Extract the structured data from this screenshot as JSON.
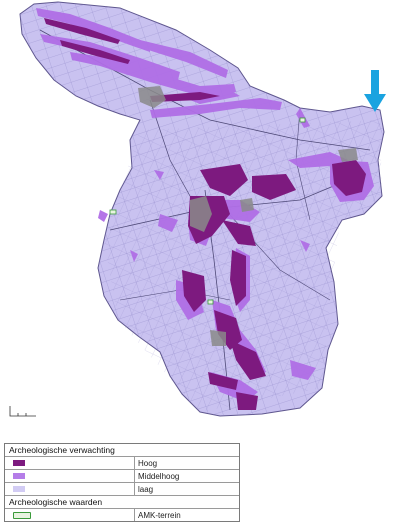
{
  "legend": {
    "section1_title": "Archeologische verwachting",
    "items": [
      {
        "label": "Hoog",
        "color": "#7d1a7f"
      },
      {
        "label": "Middelhoog",
        "color": "#b57de8"
      },
      {
        "label": "laag",
        "color": "#d2ccf4"
      }
    ],
    "section2_title": "Archeologische waarden",
    "amk": {
      "label": "AMK-terrein",
      "stroke": "#3a9a3a",
      "fill": "#e8f4e0"
    }
  },
  "map": {
    "low_color": "#c9c2f0",
    "middle_color": "#b06ee6",
    "high_color": "#7d1a7f",
    "town_color": "#8a8a8a",
    "arrow_color": "#1aa3e0",
    "north_arrow": "arrow-down-icon"
  }
}
